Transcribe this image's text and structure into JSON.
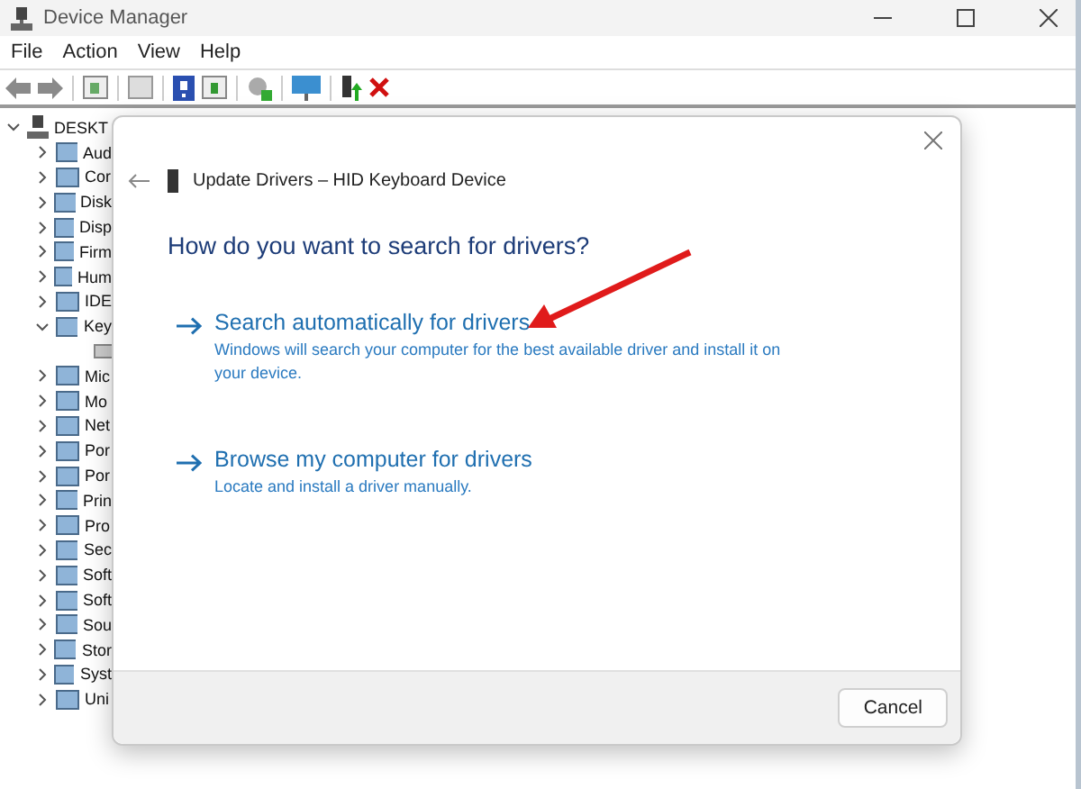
{
  "window": {
    "title": "Device Manager"
  },
  "menu": [
    "File",
    "Action",
    "View",
    "Help"
  ],
  "tree": [
    {
      "label": "DESKT",
      "kind": "group",
      "expanded": true,
      "children": [
        {
          "label": "Aud",
          "kind": "group",
          "expanded": false
        },
        {
          "label": "Cor",
          "kind": "group",
          "expanded": false
        },
        {
          "label": "Disk",
          "kind": "group",
          "expanded": false
        },
        {
          "label": "Disp",
          "kind": "group",
          "expanded": false
        },
        {
          "label": "Firm",
          "kind": "group",
          "expanded": false
        },
        {
          "label": "Hum",
          "kind": "group",
          "expanded": false
        },
        {
          "label": "IDE",
          "kind": "group",
          "expanded": false
        },
        {
          "label": "Key",
          "kind": "group",
          "expanded": true,
          "children": [
            {
              "kind": "leaf"
            }
          ]
        },
        {
          "label": "Mic",
          "kind": "group",
          "expanded": false
        },
        {
          "label": "Mo",
          "kind": "group",
          "expanded": false
        },
        {
          "label": "Net",
          "kind": "group",
          "expanded": false
        },
        {
          "label": "Por",
          "kind": "group",
          "expanded": false
        },
        {
          "label": "Por",
          "kind": "group",
          "expanded": false
        },
        {
          "label": "Prin",
          "kind": "group",
          "expanded": false
        },
        {
          "label": "Pro",
          "kind": "group",
          "expanded": false
        },
        {
          "label": "Sec",
          "kind": "group",
          "expanded": false
        },
        {
          "label": "Soft",
          "kind": "group",
          "expanded": false
        },
        {
          "label": "Soft",
          "kind": "group",
          "expanded": false
        },
        {
          "label": "Sou",
          "kind": "group",
          "expanded": false
        },
        {
          "label": "Stor",
          "kind": "group",
          "expanded": false
        },
        {
          "label": "Syst",
          "kind": "group",
          "expanded": false
        },
        {
          "label": "Uni",
          "kind": "group",
          "expanded": false
        }
      ]
    }
  ],
  "dialog": {
    "title": "Update Drivers – HID Keyboard Device",
    "heading": "How do you want to search for drivers?",
    "options": [
      {
        "title": "Search automatically for drivers",
        "description": "Windows will search your computer for the best available driver and install it on your device."
      },
      {
        "title": "Browse my computer for drivers",
        "description": "Locate and install a driver manually."
      }
    ],
    "buttons": [
      "Cancel"
    ]
  }
}
